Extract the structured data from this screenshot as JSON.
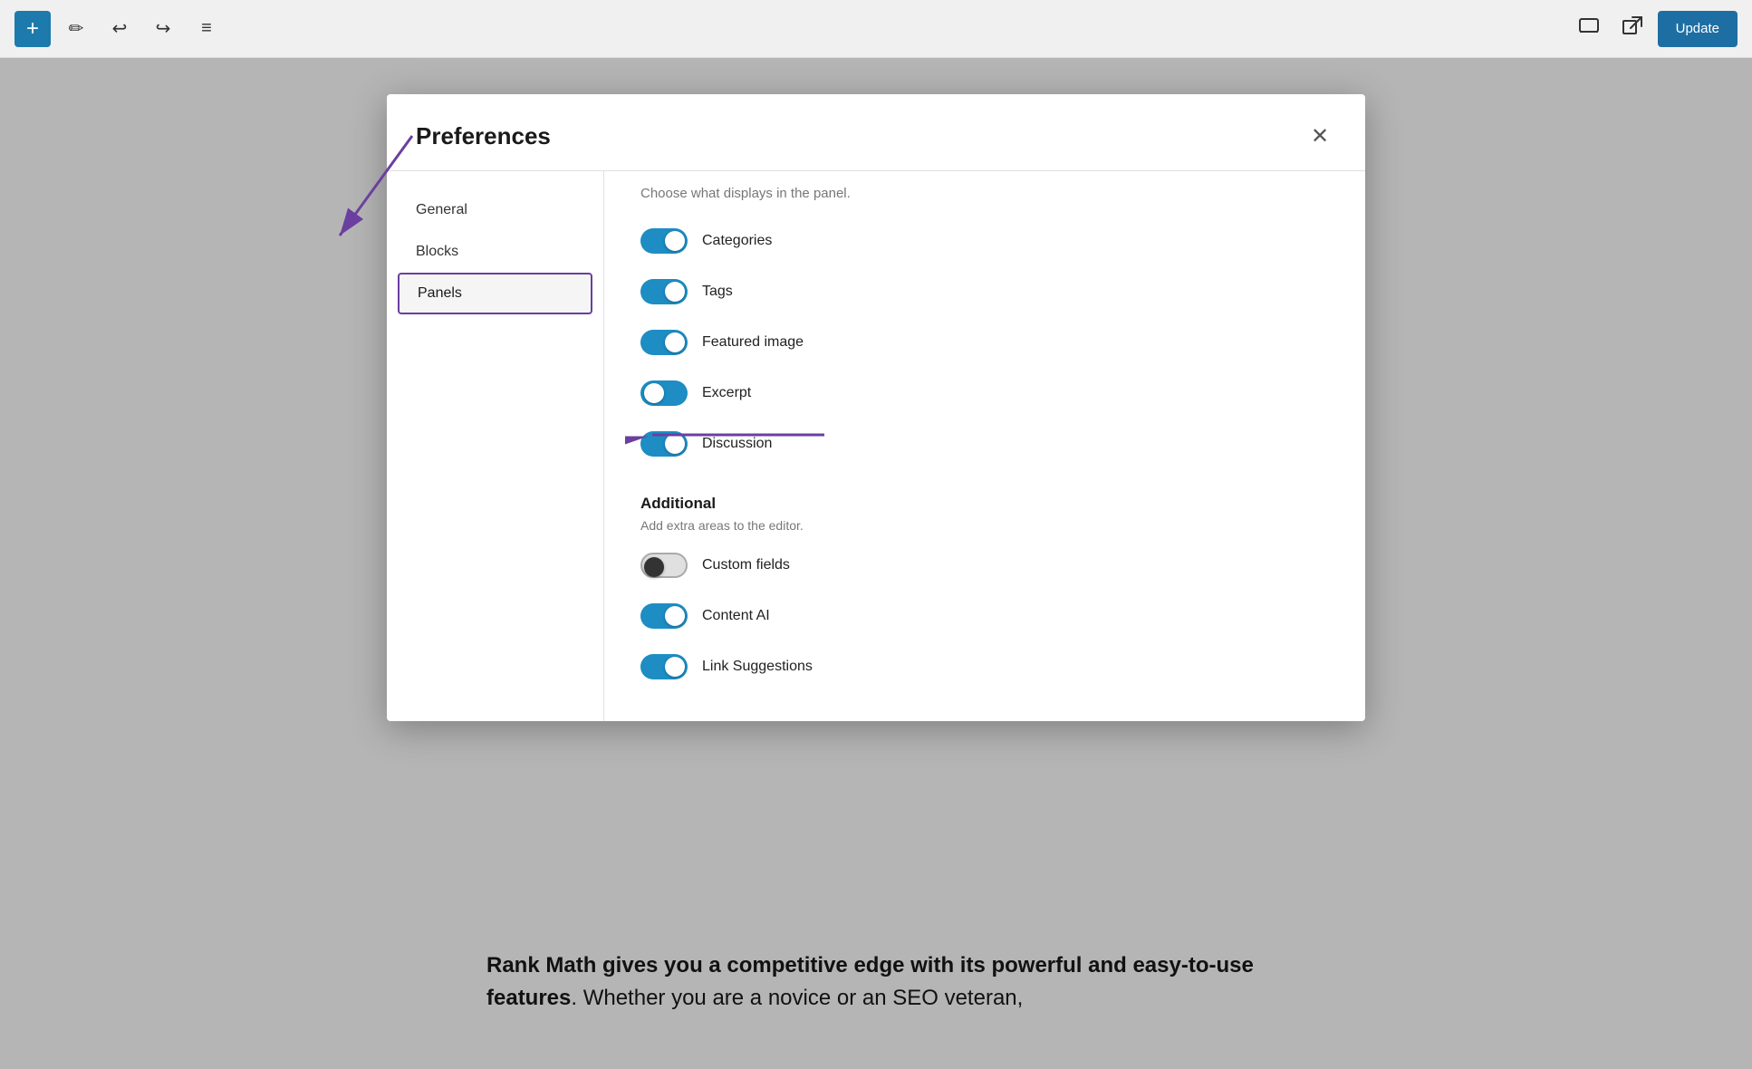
{
  "toolbar": {
    "add_label": "+",
    "pen_icon": "✏",
    "undo_icon": "↩",
    "redo_icon": "↪",
    "menu_icon": "≡",
    "preview_icon": "⬜",
    "external_icon": "⧉",
    "update_label": "Update"
  },
  "modal": {
    "title": "Preferences",
    "close_icon": "✕",
    "sidebar": {
      "items": [
        {
          "id": "general",
          "label": "General",
          "active": false
        },
        {
          "id": "blocks",
          "label": "Blocks",
          "active": false
        },
        {
          "id": "panels",
          "label": "Panels",
          "active": true
        }
      ]
    },
    "panels_section": {
      "subtitle": "Choose what displays in the panel.",
      "toggles": [
        {
          "id": "categories",
          "label": "Categories",
          "on": true
        },
        {
          "id": "tags",
          "label": "Tags",
          "on": true
        },
        {
          "id": "featured_image",
          "label": "Featured image",
          "on": true
        },
        {
          "id": "excerpt",
          "label": "Excerpt",
          "on": false
        },
        {
          "id": "discussion",
          "label": "Discussion",
          "on": true
        }
      ],
      "additional": {
        "heading": "Additional",
        "desc": "Add extra areas to the editor.",
        "toggles": [
          {
            "id": "custom_fields",
            "label": "Custom fields",
            "on": false,
            "style": "dark-thumb"
          },
          {
            "id": "content_ai",
            "label": "Content AI",
            "on": true
          },
          {
            "id": "link_suggestions",
            "label": "Link Suggestions",
            "on": true
          }
        ]
      }
    }
  },
  "bg_text": {
    "bold_part": "Rank Math gives you a competitive edge with its powerful and easy-to-use features",
    "normal_part": ". Whether you are a novice or an SEO veteran,"
  }
}
